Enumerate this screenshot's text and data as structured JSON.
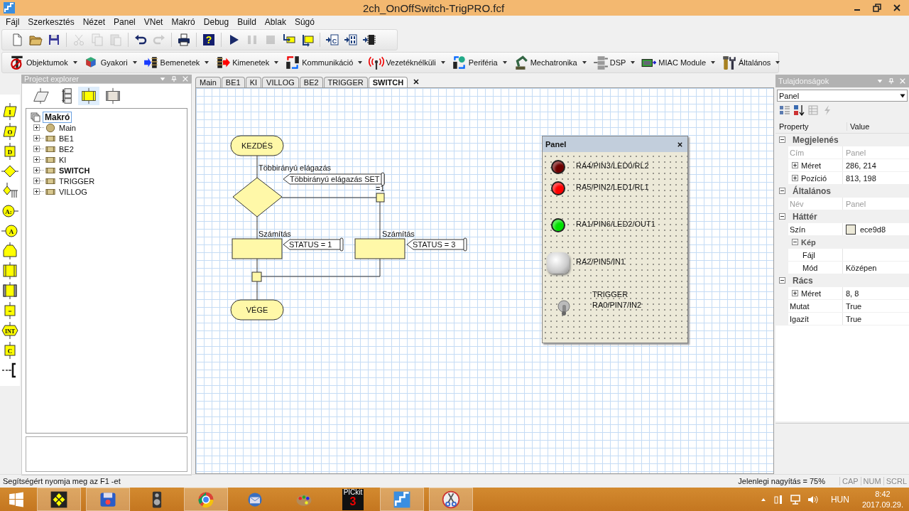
{
  "window": {
    "title": "2ch_OnOffSwitch-TrigPRO.fcf"
  },
  "menu": [
    "Fájl",
    "Szerkesztés",
    "Nézet",
    "Panel",
    "VNet",
    "Makró",
    "Debug",
    "Build",
    "Ablak",
    "Súgó"
  ],
  "toolbar": {
    "groups": [
      {
        "buttons": [
          {
            "kind": "new",
            "disabled": false
          },
          {
            "kind": "open",
            "disabled": false
          },
          {
            "kind": "save",
            "disabled": false
          }
        ]
      },
      {
        "buttons": [
          {
            "kind": "cut",
            "disabled": true
          },
          {
            "kind": "copy",
            "disabled": true
          },
          {
            "kind": "paste",
            "disabled": true
          }
        ]
      },
      {
        "buttons": [
          {
            "kind": "undo",
            "disabled": false
          },
          {
            "kind": "redo",
            "disabled": true
          }
        ]
      },
      {
        "buttons": [
          {
            "kind": "print",
            "disabled": false
          }
        ]
      },
      {
        "buttons": [
          {
            "kind": "help",
            "glyph": "?",
            "disabled": false
          }
        ]
      },
      {
        "buttons": [
          {
            "kind": "play",
            "disabled": false
          },
          {
            "kind": "pause",
            "disabled": true
          },
          {
            "kind": "stop",
            "disabled": true
          },
          {
            "kind": "step_into",
            "disabled": false
          },
          {
            "kind": "step_over",
            "disabled": false
          }
        ]
      },
      {
        "buttons": [
          {
            "kind": "to_c",
            "glyph": "C",
            "disabled": false
          },
          {
            "kind": "to_hex",
            "disabled": false
          },
          {
            "kind": "to_chip",
            "disabled": false
          }
        ]
      }
    ]
  },
  "component_toolbar": [
    {
      "kind": "objects",
      "label": "Objektumok"
    },
    {
      "kind": "common",
      "label": "Gyakori"
    },
    {
      "kind": "inputs",
      "label": "Bemenetek"
    },
    {
      "kind": "outputs",
      "label": "Kimenetek"
    },
    {
      "kind": "comms",
      "label": "Kommunikáció"
    },
    {
      "kind": "wireless",
      "label": "Vezetéknélküli"
    },
    {
      "kind": "peripheral",
      "label": "Periféria"
    },
    {
      "kind": "mechatronics",
      "label": "Mechatronika"
    },
    {
      "kind": "dsp",
      "label": "DSP"
    },
    {
      "kind": "miac",
      "label": "MIAC Module"
    },
    {
      "kind": "general",
      "label": "Általános"
    }
  ],
  "tools": [
    {
      "kind": "para",
      "glyph": "I"
    },
    {
      "kind": "para",
      "glyph": "O"
    },
    {
      "kind": "box",
      "glyph": "D"
    },
    {
      "kind": "diamond"
    },
    {
      "kind": "switch"
    },
    {
      "kind": "circle_right",
      "glyph": "A:"
    },
    {
      "kind": "circle_left",
      "glyph": "A"
    },
    {
      "kind": "loop"
    },
    {
      "kind": "macro"
    },
    {
      "kind": "component_macro"
    },
    {
      "kind": "box",
      "glyph": "="
    },
    {
      "kind": "interrupt",
      "glyph": "INT"
    },
    {
      "kind": "box",
      "glyph": "C"
    },
    {
      "kind": "comment"
    }
  ],
  "project_explorer": {
    "title": "Project explorer",
    "tabs": [
      {
        "kind": "flowchart",
        "selected": false
      },
      {
        "kind": "variables",
        "selected": false
      },
      {
        "kind": "macros",
        "selected": true
      },
      {
        "kind": "components",
        "selected": false
      }
    ],
    "root": {
      "label": "Makró",
      "selected": true
    },
    "items": [
      {
        "kind": "main",
        "label": "Main",
        "current": false
      },
      {
        "kind": "macro",
        "label": "BE1",
        "current": false
      },
      {
        "kind": "macro",
        "label": "BE2",
        "current": false
      },
      {
        "kind": "macro",
        "label": "KI",
        "current": false
      },
      {
        "kind": "macro",
        "label": "SWITCH",
        "current": true
      },
      {
        "kind": "macro",
        "label": "TRIGGER",
        "current": false
      },
      {
        "kind": "macro",
        "label": "VILLOG",
        "current": false
      }
    ]
  },
  "tabs": [
    {
      "label": "Main",
      "selected": false
    },
    {
      "label": "BE1",
      "selected": false
    },
    {
      "label": "KI",
      "selected": false
    },
    {
      "label": "VILLOG",
      "selected": false
    },
    {
      "label": "BE2",
      "selected": false
    },
    {
      "label": "TRIGGER",
      "selected": false
    },
    {
      "label": "SWITCH",
      "selected": true
    }
  ],
  "flowchart": {
    "start": "KEZDÉS",
    "end": "VÉGE",
    "switch_label": "Többirányú elágazás",
    "switch_comment": "Többirányú elágazás SET",
    "branch_label": "=1",
    "calculations": [
      {
        "label": "Számítás",
        "comment": "STATUS = 1"
      },
      {
        "label": "Számítás",
        "comment": "STATUS = 3"
      }
    ]
  },
  "panel": {
    "title": "Panel",
    "components": [
      {
        "kind": "led",
        "color": "#6e0000",
        "label": "RA4/PIN3/LED0/RL2"
      },
      {
        "kind": "led",
        "color": "#ff0000",
        "label": "RA5/PIN2/LED1/RL1"
      },
      {
        "kind": "led",
        "color": "#00e000",
        "label": "RA1/PIN6/LED2/OUT1"
      },
      {
        "kind": "push_button",
        "label": "RA2/PIN5/IN1"
      },
      {
        "kind": "toggle_switch",
        "label": "TRIGGER",
        "sublabel": "RA0/PIN7/IN2",
        "on": false
      }
    ]
  },
  "properties": {
    "title": "Tulajdonságok",
    "object": "Panel",
    "columns": [
      "Property",
      "Value"
    ],
    "rows": [
      {
        "kind": "category",
        "label": "Megjelenés",
        "expanded": true,
        "children": [
          {
            "label": "Cím",
            "value": "Panel",
            "disabled": true
          },
          {
            "label": "Méret",
            "value": "286, 214",
            "disabled": false,
            "expanded": false
          },
          {
            "label": "Pozíció",
            "value": "813, 198",
            "disabled": false,
            "expanded": false
          }
        ]
      },
      {
        "kind": "category",
        "label": "Általános",
        "expanded": true,
        "children": [
          {
            "label": "Név",
            "value": "Panel",
            "disabled": true
          }
        ]
      },
      {
        "kind": "category",
        "label": "Háttér",
        "expanded": true,
        "children": [
          {
            "kind": "color",
            "label": "Szín",
            "value": "ece9d8",
            "disabled": false
          },
          {
            "kind": "category",
            "label": "Kép",
            "expanded": true,
            "children": [
              {
                "label": "Fájl",
                "disabled": false
              },
              {
                "label": "Mód",
                "value": "Középen",
                "disabled": false
              }
            ]
          }
        ]
      },
      {
        "kind": "category",
        "label": "Rács",
        "expanded": true,
        "children": [
          {
            "label": "Méret",
            "value": "8, 8",
            "disabled": false,
            "expanded": false
          },
          {
            "label": "Mutat",
            "value": "True",
            "disabled": false
          },
          {
            "label": "Igazít",
            "value": "True",
            "disabled": false
          }
        ]
      }
    ]
  },
  "status_bar": {
    "help": "Segítségért nyomja meg az F1 -et",
    "zoom": "Jelenlegi nagyítás = 75%",
    "indicators": [
      "CAP",
      "NUM",
      "SCRL"
    ]
  },
  "taskbar": {
    "apps": [
      {
        "kind": "flowchart_tool",
        "running": true
      },
      {
        "kind": "floppy",
        "running": true
      },
      {
        "kind": "speaker",
        "running": false
      },
      {
        "kind": "chrome",
        "running": true
      },
      {
        "kind": "mail",
        "running": false
      },
      {
        "kind": "palette",
        "running": false
      },
      {
        "kind": "pickit",
        "label": "PICkit",
        "sublabel": "3",
        "running": false
      },
      {
        "kind": "flowcode",
        "running": true
      },
      {
        "kind": "scissors",
        "running": true
      }
    ],
    "language": "HUN",
    "time": "8:42",
    "date": "2017.09.29."
  }
}
